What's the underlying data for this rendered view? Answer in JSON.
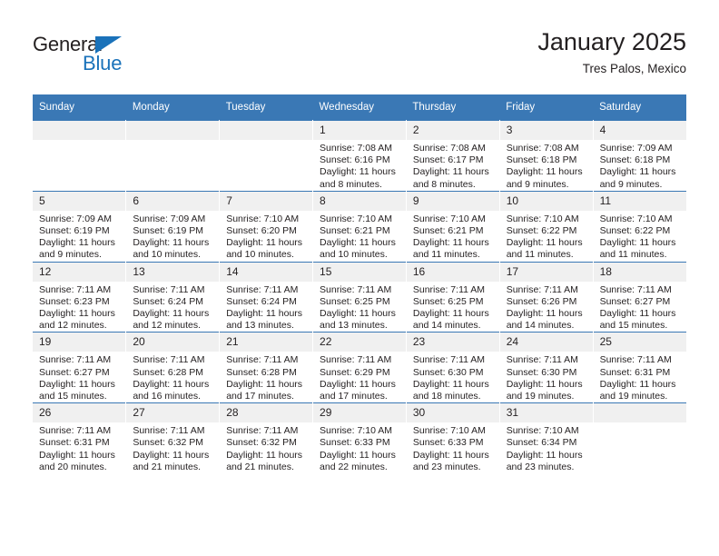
{
  "logo": {
    "word_one": "General",
    "word_two": "Blue",
    "triangle_color": "#1a72ba"
  },
  "header": {
    "title": "January 2025",
    "subtitle": "Tres Palos, Mexico"
  },
  "theme": {
    "header_blue": "#3a78b5",
    "daynum_background": "#f0f0f0",
    "text_color": "#231f20"
  },
  "calendar": {
    "weekday_headers": [
      "Sunday",
      "Monday",
      "Tuesday",
      "Wednesday",
      "Thursday",
      "Friday",
      "Saturday"
    ],
    "weeks": [
      [
        {
          "day": "",
          "empty": true
        },
        {
          "day": "",
          "empty": true
        },
        {
          "day": "",
          "empty": true
        },
        {
          "day": "1",
          "sunrise": "Sunrise: 7:08 AM",
          "sunset": "Sunset: 6:16 PM",
          "daylight_line1": "Daylight: 11 hours",
          "daylight_line2": "and 8 minutes."
        },
        {
          "day": "2",
          "sunrise": "Sunrise: 7:08 AM",
          "sunset": "Sunset: 6:17 PM",
          "daylight_line1": "Daylight: 11 hours",
          "daylight_line2": "and 8 minutes."
        },
        {
          "day": "3",
          "sunrise": "Sunrise: 7:08 AM",
          "sunset": "Sunset: 6:18 PM",
          "daylight_line1": "Daylight: 11 hours",
          "daylight_line2": "and 9 minutes."
        },
        {
          "day": "4",
          "sunrise": "Sunrise: 7:09 AM",
          "sunset": "Sunset: 6:18 PM",
          "daylight_line1": "Daylight: 11 hours",
          "daylight_line2": "and 9 minutes."
        }
      ],
      [
        {
          "day": "5",
          "sunrise": "Sunrise: 7:09 AM",
          "sunset": "Sunset: 6:19 PM",
          "daylight_line1": "Daylight: 11 hours",
          "daylight_line2": "and 9 minutes."
        },
        {
          "day": "6",
          "sunrise": "Sunrise: 7:09 AM",
          "sunset": "Sunset: 6:19 PM",
          "daylight_line1": "Daylight: 11 hours",
          "daylight_line2": "and 10 minutes."
        },
        {
          "day": "7",
          "sunrise": "Sunrise: 7:10 AM",
          "sunset": "Sunset: 6:20 PM",
          "daylight_line1": "Daylight: 11 hours",
          "daylight_line2": "and 10 minutes."
        },
        {
          "day": "8",
          "sunrise": "Sunrise: 7:10 AM",
          "sunset": "Sunset: 6:21 PM",
          "daylight_line1": "Daylight: 11 hours",
          "daylight_line2": "and 10 minutes."
        },
        {
          "day": "9",
          "sunrise": "Sunrise: 7:10 AM",
          "sunset": "Sunset: 6:21 PM",
          "daylight_line1": "Daylight: 11 hours",
          "daylight_line2": "and 11 minutes."
        },
        {
          "day": "10",
          "sunrise": "Sunrise: 7:10 AM",
          "sunset": "Sunset: 6:22 PM",
          "daylight_line1": "Daylight: 11 hours",
          "daylight_line2": "and 11 minutes."
        },
        {
          "day": "11",
          "sunrise": "Sunrise: 7:10 AM",
          "sunset": "Sunset: 6:22 PM",
          "daylight_line1": "Daylight: 11 hours",
          "daylight_line2": "and 11 minutes."
        }
      ],
      [
        {
          "day": "12",
          "sunrise": "Sunrise: 7:11 AM",
          "sunset": "Sunset: 6:23 PM",
          "daylight_line1": "Daylight: 11 hours",
          "daylight_line2": "and 12 minutes."
        },
        {
          "day": "13",
          "sunrise": "Sunrise: 7:11 AM",
          "sunset": "Sunset: 6:24 PM",
          "daylight_line1": "Daylight: 11 hours",
          "daylight_line2": "and 12 minutes."
        },
        {
          "day": "14",
          "sunrise": "Sunrise: 7:11 AM",
          "sunset": "Sunset: 6:24 PM",
          "daylight_line1": "Daylight: 11 hours",
          "daylight_line2": "and 13 minutes."
        },
        {
          "day": "15",
          "sunrise": "Sunrise: 7:11 AM",
          "sunset": "Sunset: 6:25 PM",
          "daylight_line1": "Daylight: 11 hours",
          "daylight_line2": "and 13 minutes."
        },
        {
          "day": "16",
          "sunrise": "Sunrise: 7:11 AM",
          "sunset": "Sunset: 6:25 PM",
          "daylight_line1": "Daylight: 11 hours",
          "daylight_line2": "and 14 minutes."
        },
        {
          "day": "17",
          "sunrise": "Sunrise: 7:11 AM",
          "sunset": "Sunset: 6:26 PM",
          "daylight_line1": "Daylight: 11 hours",
          "daylight_line2": "and 14 minutes."
        },
        {
          "day": "18",
          "sunrise": "Sunrise: 7:11 AM",
          "sunset": "Sunset: 6:27 PM",
          "daylight_line1": "Daylight: 11 hours",
          "daylight_line2": "and 15 minutes."
        }
      ],
      [
        {
          "day": "19",
          "sunrise": "Sunrise: 7:11 AM",
          "sunset": "Sunset: 6:27 PM",
          "daylight_line1": "Daylight: 11 hours",
          "daylight_line2": "and 15 minutes."
        },
        {
          "day": "20",
          "sunrise": "Sunrise: 7:11 AM",
          "sunset": "Sunset: 6:28 PM",
          "daylight_line1": "Daylight: 11 hours",
          "daylight_line2": "and 16 minutes."
        },
        {
          "day": "21",
          "sunrise": "Sunrise: 7:11 AM",
          "sunset": "Sunset: 6:28 PM",
          "daylight_line1": "Daylight: 11 hours",
          "daylight_line2": "and 17 minutes."
        },
        {
          "day": "22",
          "sunrise": "Sunrise: 7:11 AM",
          "sunset": "Sunset: 6:29 PM",
          "daylight_line1": "Daylight: 11 hours",
          "daylight_line2": "and 17 minutes."
        },
        {
          "day": "23",
          "sunrise": "Sunrise: 7:11 AM",
          "sunset": "Sunset: 6:30 PM",
          "daylight_line1": "Daylight: 11 hours",
          "daylight_line2": "and 18 minutes."
        },
        {
          "day": "24",
          "sunrise": "Sunrise: 7:11 AM",
          "sunset": "Sunset: 6:30 PM",
          "daylight_line1": "Daylight: 11 hours",
          "daylight_line2": "and 19 minutes."
        },
        {
          "day": "25",
          "sunrise": "Sunrise: 7:11 AM",
          "sunset": "Sunset: 6:31 PM",
          "daylight_line1": "Daylight: 11 hours",
          "daylight_line2": "and 19 minutes."
        }
      ],
      [
        {
          "day": "26",
          "sunrise": "Sunrise: 7:11 AM",
          "sunset": "Sunset: 6:31 PM",
          "daylight_line1": "Daylight: 11 hours",
          "daylight_line2": "and 20 minutes."
        },
        {
          "day": "27",
          "sunrise": "Sunrise: 7:11 AM",
          "sunset": "Sunset: 6:32 PM",
          "daylight_line1": "Daylight: 11 hours",
          "daylight_line2": "and 21 minutes."
        },
        {
          "day": "28",
          "sunrise": "Sunrise: 7:11 AM",
          "sunset": "Sunset: 6:32 PM",
          "daylight_line1": "Daylight: 11 hours",
          "daylight_line2": "and 21 minutes."
        },
        {
          "day": "29",
          "sunrise": "Sunrise: 7:10 AM",
          "sunset": "Sunset: 6:33 PM",
          "daylight_line1": "Daylight: 11 hours",
          "daylight_line2": "and 22 minutes."
        },
        {
          "day": "30",
          "sunrise": "Sunrise: 7:10 AM",
          "sunset": "Sunset: 6:33 PM",
          "daylight_line1": "Daylight: 11 hours",
          "daylight_line2": "and 23 minutes."
        },
        {
          "day": "31",
          "sunrise": "Sunrise: 7:10 AM",
          "sunset": "Sunset: 6:34 PM",
          "daylight_line1": "Daylight: 11 hours",
          "daylight_line2": "and 23 minutes."
        },
        {
          "day": "",
          "empty": true
        }
      ]
    ]
  }
}
